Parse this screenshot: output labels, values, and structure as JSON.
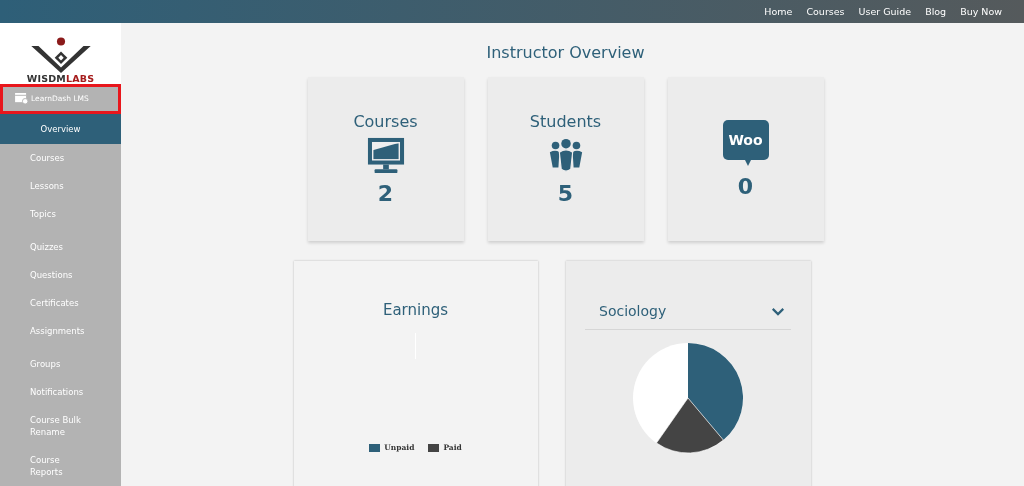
{
  "top_nav": [
    {
      "label": "Home"
    },
    {
      "label": "Courses"
    },
    {
      "label": "User Guide"
    },
    {
      "label": "Blog"
    },
    {
      "label": "Buy Now"
    }
  ],
  "sidebar": {
    "logo": {
      "text_plain": "WISDM",
      "text_bold": "LABS"
    },
    "plugin": {
      "label": "LearnDash LMS",
      "highlighted": true
    },
    "items": [
      {
        "label": "Overview",
        "selected": true
      },
      {
        "label": "Courses",
        "selected": false
      },
      {
        "label": "Lessons",
        "selected": false
      },
      {
        "label": "Topics",
        "selected": false
      },
      {
        "label": "Quizzes",
        "selected": false
      },
      {
        "label": "Questions",
        "selected": false
      },
      {
        "label": "Certificates",
        "selected": false
      },
      {
        "label": "Assignments",
        "selected": false
      },
      {
        "label": "Groups",
        "selected": false
      },
      {
        "label": "Notifications",
        "selected": false
      },
      {
        "label": "Course Bulk Rename",
        "selected": false
      },
      {
        "label": "Course Reports",
        "selected": false
      }
    ]
  },
  "title": "Instructor Overview",
  "stats": [
    {
      "kind": "courses",
      "label": "Courses",
      "value": "2"
    },
    {
      "kind": "students",
      "label": "Students",
      "value": "5"
    },
    {
      "kind": "woo",
      "icon_text": "Woo",
      "value": "0"
    }
  ],
  "earnings": {
    "title": "Earnings",
    "legend": [
      {
        "label": "Unpaid",
        "color": "#2e6079"
      },
      {
        "label": "Paid",
        "color": "#444444"
      }
    ]
  },
  "course_chart": {
    "course": "Sociology"
  }
}
